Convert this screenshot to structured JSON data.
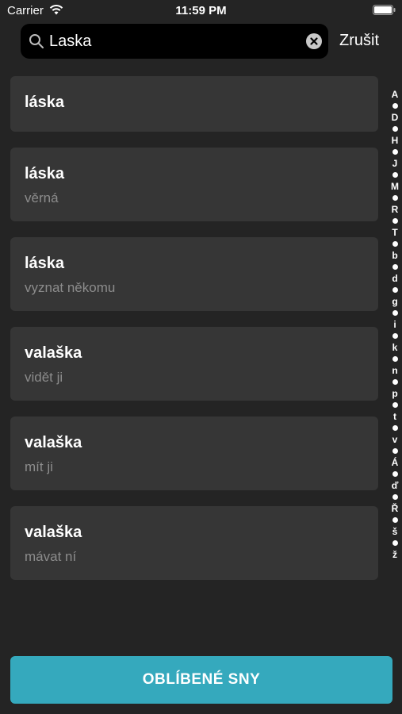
{
  "status_bar": {
    "carrier": "Carrier",
    "time": "11:59 PM"
  },
  "search": {
    "value": "Laska",
    "cancel_label": "Zrušit"
  },
  "results": [
    {
      "title": "láska",
      "subtitle": ""
    },
    {
      "title": "láska",
      "subtitle": "věrná"
    },
    {
      "title": "láska",
      "subtitle": "vyznat někomu"
    },
    {
      "title": "valaška",
      "subtitle": "vidět ji"
    },
    {
      "title": "valaška",
      "subtitle": "mít ji"
    },
    {
      "title": "valaška",
      "subtitle": "mávat ní"
    }
  ],
  "index_letters": [
    "A",
    "D",
    "H",
    "J",
    "M",
    "R",
    "T",
    "b",
    "d",
    "g",
    "i",
    "k",
    "n",
    "p",
    "t",
    "v",
    "Á",
    "ď",
    "Ř",
    "š",
    "ž"
  ],
  "favorites_button": {
    "label": "OBLÍBENÉ SNY"
  },
  "colors": {
    "background": "#242424",
    "card": "#363636",
    "accent": "#35a9bd"
  }
}
